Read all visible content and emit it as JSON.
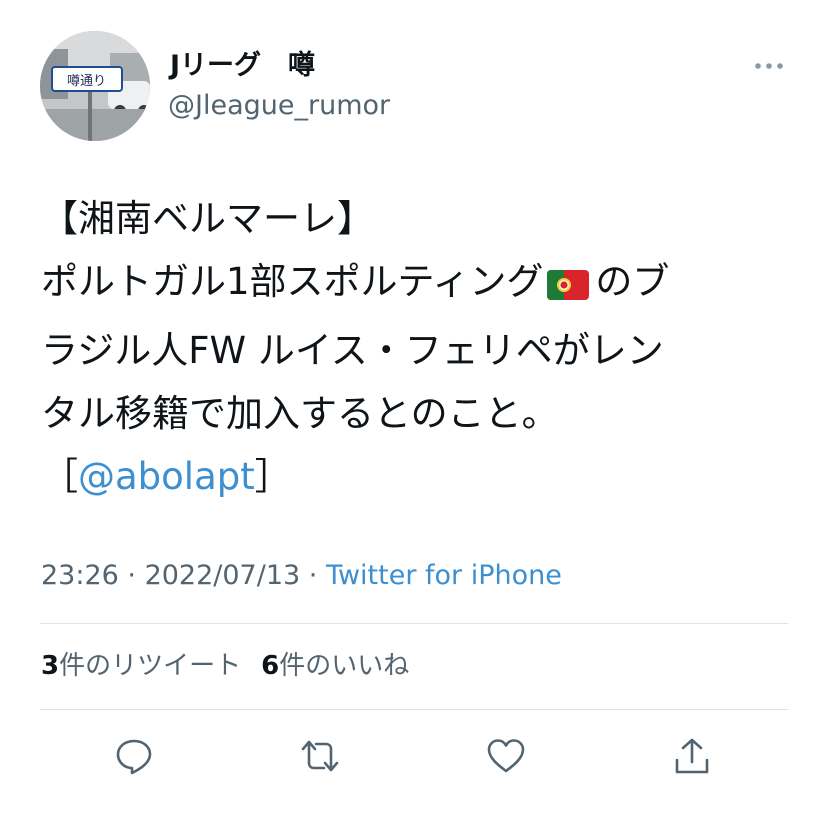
{
  "user": {
    "display_name": "Jリーグ　噂",
    "handle": "@Jleague_rumor",
    "avatar_sign_text": "噂通り"
  },
  "tweet": {
    "line1": "【湘南ベルマーレ】",
    "line2_a": "ポルトガル1部スポルティング",
    "flag_icon": "portugal-flag",
    "line2_b": "のブ",
    "line3": "ラジル人FW ルイス・フェリペがレン",
    "line4": "タル移籍で加入するとのこと。",
    "line5_open": "［",
    "mention": "@abolapt",
    "line5_close": "］"
  },
  "meta": {
    "time": "23:26",
    "separator": " · ",
    "date": "2022/07/13",
    "source": "Twitter for iPhone"
  },
  "stats": {
    "retweets_count": "3",
    "retweets_label": "件のリツイート",
    "likes_count": "6",
    "likes_label": "件のいいね"
  },
  "actions": [
    "reply-icon",
    "retweet-icon",
    "like-icon",
    "share-icon"
  ],
  "colors": {
    "link": "#3d8fd0",
    "secondary_text": "#536471",
    "icon": "#536471",
    "divider": "#dfe3e6"
  }
}
